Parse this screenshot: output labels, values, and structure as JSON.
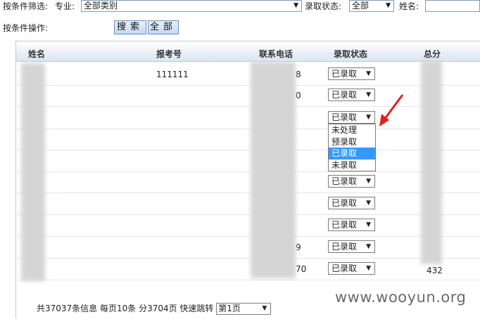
{
  "filter": {
    "label": "按条件筛选:",
    "major_label": "专业:",
    "major_value": "全部类别",
    "status_label": "录取状态:",
    "status_value": "全部",
    "name_label": "姓名:"
  },
  "ops": {
    "label": "按条件操作:",
    "search_btn": "搜索",
    "all_btn": "全部"
  },
  "table": {
    "headers": [
      "姓名",
      "报考号",
      "联系电话",
      "录取状态",
      "总分"
    ],
    "rows": [
      {
        "exam_no": "111111",
        "phone_tail": "8",
        "status": "已录取",
        "score": ""
      },
      {
        "exam_no": "",
        "phone_tail": "0",
        "status": "已录取",
        "score": ""
      },
      {
        "exam_no": "",
        "phone_tail": "",
        "status": "已录取",
        "score": ""
      },
      {
        "exam_no": "",
        "phone_tail": "",
        "status": "",
        "score": ""
      },
      {
        "exam_no": "",
        "phone_tail": "",
        "status": "",
        "score": ""
      },
      {
        "exam_no": "",
        "phone_tail": "",
        "status": "已录取",
        "score": ""
      },
      {
        "exam_no": "",
        "phone_tail": "",
        "status": "已录取",
        "score": ""
      },
      {
        "exam_no": "",
        "phone_tail": "",
        "status": "已录取",
        "score": ""
      },
      {
        "exam_no": "",
        "phone_tail": "9",
        "status": "已录取",
        "score": ""
      },
      {
        "exam_no": "",
        "phone_tail": "70",
        "status": "已录取",
        "score": "432"
      }
    ]
  },
  "dropdown_options": [
    "未处理",
    "预录取",
    "已录取",
    "未录取"
  ],
  "dropdown_selected": "已录取",
  "footer": {
    "summary": "共37037条信息 每页10条 分3704页 快速跳转",
    "page_select": "第1页"
  },
  "watermark": "www.wooyun.org",
  "colors": {
    "arrow": "#e02020",
    "highlight": "#3399ff"
  }
}
